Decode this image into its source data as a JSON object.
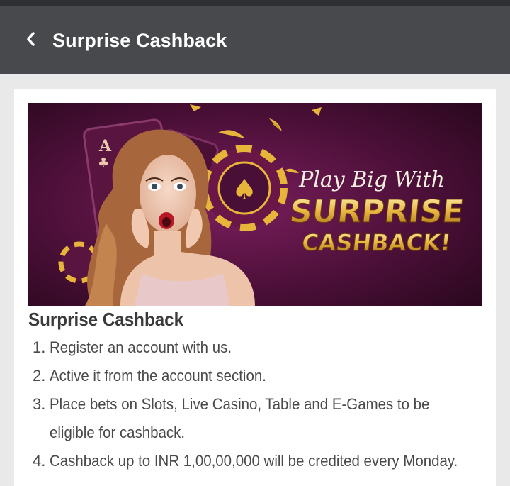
{
  "header": {
    "title": "Surprise Cashback",
    "back_icon": "chevron-left-icon"
  },
  "banner": {
    "line1": "Play Big With",
    "line2": "SURPRISE",
    "line3": "CASHBACK!",
    "card_letter": "A",
    "colors": {
      "bg": "#3b0b2c",
      "gold": "#e6b53a",
      "cream": "#f7efe0"
    }
  },
  "content": {
    "title": "Surprise Cashback",
    "steps": [
      {
        "num": "1.",
        "lines": [
          "Register an account with us."
        ]
      },
      {
        "num": "2.",
        "lines": [
          "Active it from the account section."
        ]
      },
      {
        "num": "3.",
        "lines": [
          "Place bets on Slots, Live Casino, Table and E-Games to be",
          "eligible for cashback."
        ]
      },
      {
        "num": "4.",
        "lines": [
          "Cashback up to INR 1,00,00,000 will be credited every Monday."
        ]
      }
    ]
  },
  "colors": {
    "header_bg": "#47494c",
    "top_strip": "#2e3033",
    "page_bg": "#e9e9e9",
    "card_bg": "#ffffff",
    "text": "#4a4a4a"
  }
}
